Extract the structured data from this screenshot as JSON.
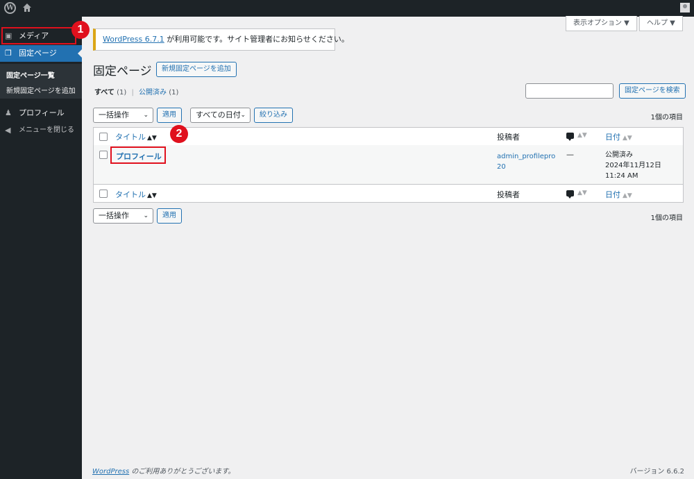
{
  "sidebar": {
    "media_label": "メディア",
    "pages_label": "固定ページ",
    "sub_all_pages": "固定ページ一覧",
    "sub_add_new": "新規固定ページを追加",
    "profile_label": "プロフィール",
    "collapse_label": "メニューを閉じる"
  },
  "badges": {
    "one": "1",
    "two": "2"
  },
  "header": {
    "screen_options": "表示オプション ▼",
    "help": "ヘルプ ▼"
  },
  "notice": {
    "link_text": "WordPress 6.7.1",
    "text": " が利用可能です。サイト管理者にお知らせください。"
  },
  "main": {
    "title": "固定ページ",
    "add_new_button": "新規固定ページを追加",
    "filter_all": "すべて",
    "filter_all_count": "(1)",
    "filter_separator": "|",
    "filter_published": "公開済み",
    "filter_published_count": "(1)",
    "search_button": "固定ページを検索",
    "bulk_action": "一括操作",
    "apply": "適用",
    "all_dates": "すべての日付",
    "filter_button": "絞り込み",
    "items_count": "1個の項目"
  },
  "table": {
    "columns": {
      "title": "タイトル",
      "author": "投稿者",
      "date": "日付"
    },
    "rows": [
      {
        "title": "プロフィール",
        "author": "admin_profilepro20",
        "comments": "—",
        "status": "公開済み",
        "date": "2024年11月12日 11:24 AM"
      }
    ]
  },
  "footer": {
    "wp_link": "WordPress",
    "thanks": " のご利用ありがとうございます。",
    "version": "バージョン 6.6.2"
  },
  "colors": {
    "accent": "#2271b1",
    "highlight": "#e0101d",
    "admin_bar": "#1d2327"
  }
}
